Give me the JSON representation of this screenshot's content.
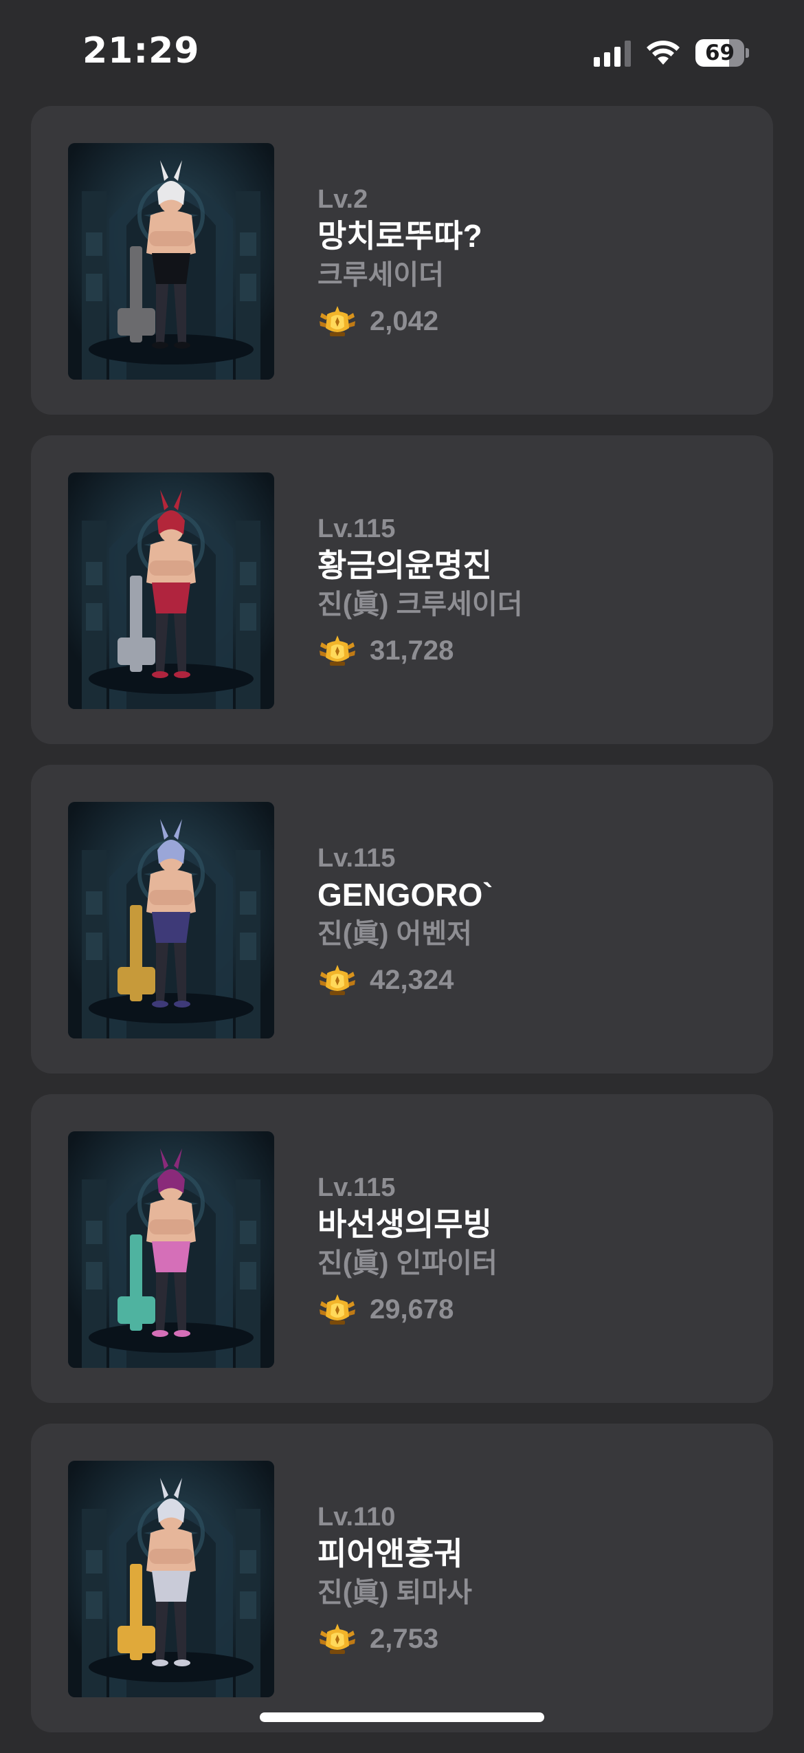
{
  "status_bar": {
    "time": "21:29",
    "battery": "69",
    "battery_level": 0.69,
    "icons": [
      "cellular-signal-icon",
      "wifi-icon",
      "battery-icon"
    ]
  },
  "characters": [
    {
      "level": "Lv.2",
      "name": "망치로뚜따?",
      "job": "크루세이더",
      "fame": "2,042",
      "hair_color": "#e8e8ea",
      "outfit_color": "#111318",
      "weapon_color": "#6b6b6e"
    },
    {
      "level": "Lv.115",
      "name": "황금의윤명진",
      "job": "진(眞) 크루세이더",
      "fame": "31,728",
      "hair_color": "#b3263a",
      "outfit_color": "#b0243e",
      "weapon_color": "#9ea3ad"
    },
    {
      "level": "Lv.115",
      "name": "GENGORO`",
      "job": "진(眞) 어벤저",
      "fame": "42,324",
      "hair_color": "#9aa6d8",
      "outfit_color": "#3e3a78",
      "weapon_color": "#c79a3a"
    },
    {
      "level": "Lv.115",
      "name": "바선생의무빙",
      "job": "진(眞) 인파이터",
      "fame": "29,678",
      "hair_color": "#8a2a7a",
      "outfit_color": "#d56fb8",
      "weapon_color": "#4fb3a0"
    },
    {
      "level": "Lv.110",
      "name": "피어앤흥궈",
      "job": "진(眞) 퇴마사",
      "fame": "2,753",
      "hair_color": "#d8dbe6",
      "outfit_color": "#c9cbd8",
      "weapon_color": "#e0a93a"
    }
  ],
  "colors": {
    "background": "#2c2c2e",
    "card": "#38383b",
    "secondary_text": "#8e8e93",
    "fame_gold": "#f2b42a"
  }
}
